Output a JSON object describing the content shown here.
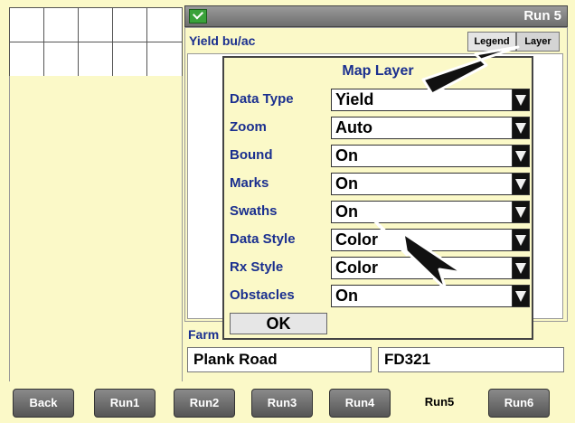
{
  "header": {
    "title": "Run 5",
    "status_icon": "checkmark-icon"
  },
  "map": {
    "yield_label": "Yield bu/ac",
    "legend_button": "Legend",
    "layer_button": "Layer"
  },
  "popup": {
    "title": "Map Layer",
    "rows": [
      {
        "label": "Data Type",
        "value": "Yield"
      },
      {
        "label": "Zoom",
        "value": "Auto"
      },
      {
        "label": "Bound",
        "value": "On"
      },
      {
        "label": "Marks",
        "value": "On"
      },
      {
        "label": "Swaths",
        "value": "On"
      },
      {
        "label": "Data Style",
        "value": "Color"
      },
      {
        "label": "Rx Style",
        "value": "Color"
      },
      {
        "label": "Obstacles",
        "value": "On"
      }
    ],
    "ok_label": "OK"
  },
  "footer": {
    "farm_label": "Farm",
    "field_left": "Plank Road",
    "field_right": "FD321"
  },
  "tabs": [
    "Back",
    "Run1",
    "Run2",
    "Run3",
    "Run4",
    "Run5",
    "Run6"
  ],
  "active_tab": "Run5",
  "colors": {
    "background": "#fbf9c8",
    "label_blue": "#1a2f8f",
    "header_gray": "#7a7a7a"
  }
}
